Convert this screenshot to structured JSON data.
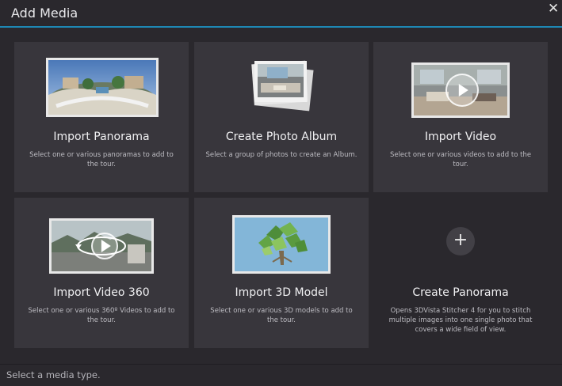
{
  "window": {
    "title": "Add Media",
    "accent_color": "#1e88b4"
  },
  "cards": [
    {
      "title": "Import Panorama",
      "description": "Select one or various panoramas to add to the tour.",
      "icon": "panorama-thumbnail-icon"
    },
    {
      "title": "Create Photo Album",
      "description": "Select a group of photos to create an Album.",
      "icon": "photo-album-thumbnail-icon"
    },
    {
      "title": "Import Video",
      "description": "Select one or various videos to add to the tour.",
      "icon": "video-thumbnail-icon"
    },
    {
      "title": "Import Video 360",
      "description": "Select one or various 360º Videos to add to the tour.",
      "icon": "video-360-thumbnail-icon"
    },
    {
      "title": "Import 3D Model",
      "description": "Select one or various 3D models to add to the tour.",
      "icon": "3d-model-thumbnail-icon"
    },
    {
      "title": "Create Panorama",
      "description": "Opens 3DVista Stitcher 4 for you to stitch multiple images into one single photo that covers a wide field of view.",
      "icon": "plus-icon",
      "plus_glyph": "+"
    }
  ],
  "status": {
    "text": "Select a media type."
  },
  "close_glyph": "✕"
}
